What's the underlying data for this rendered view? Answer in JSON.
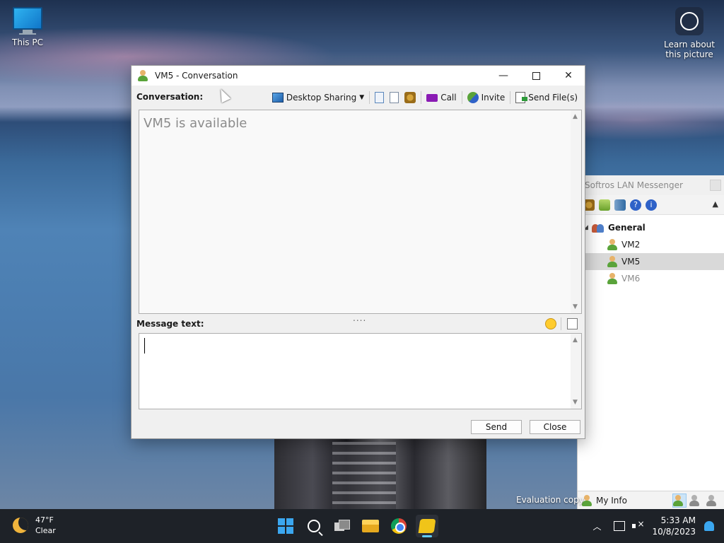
{
  "desktop": {
    "icons": [
      {
        "label": "This PC"
      },
      {
        "label": "Learn about this picture"
      }
    ],
    "eval_text": "Evaluation copy"
  },
  "conversation_window": {
    "title": "VM5 - Conversation",
    "conversation_label": "Conversation:",
    "toolbar": {
      "desktop_sharing": "Desktop Sharing",
      "call": "Call",
      "invite": "Invite",
      "send_files": "Send File(s)"
    },
    "status_message": "VM5 is available",
    "splitter": "....",
    "message_label": "Message text:",
    "message_value": "",
    "send_button": "Send",
    "close_button": "Close"
  },
  "main_window": {
    "title": "Softros LAN Messenger",
    "tree": {
      "group": "General",
      "users": [
        {
          "name": "VM2",
          "status": "online"
        },
        {
          "name": "VM5",
          "status": "online",
          "selected": true
        },
        {
          "name": "VM6",
          "status": "offline"
        }
      ]
    },
    "my_info": "My Info"
  },
  "taskbar": {
    "weather": {
      "temp": "47°F",
      "condition": "Clear"
    },
    "apps": [
      "start-button",
      "search-icon",
      "task-view-icon",
      "file-explorer-icon",
      "chrome-icon",
      "softros-icon"
    ],
    "clock": {
      "time": "5:33 AM",
      "date": "10/8/2023"
    }
  }
}
